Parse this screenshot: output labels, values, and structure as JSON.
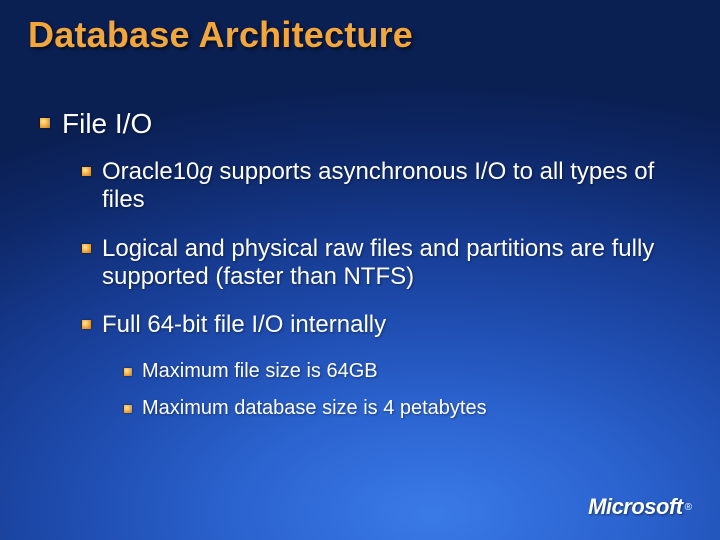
{
  "title": "Database Architecture",
  "l1_0": "File I/O",
  "l2_0_pre": "Oracle10",
  "l2_0_g": "g",
  "l2_0_post": " supports asynchronous I/O to all types of files",
  "l2_1": "Logical and physical raw files and partitions are fully supported (faster than NTFS)",
  "l2_2": "Full 64-bit file I/O internally",
  "l3_0": "Maximum file size is 64GB",
  "l3_1": "Maximum database size is 4 petabytes",
  "logo": "Microsoft",
  "logo_r": "®"
}
